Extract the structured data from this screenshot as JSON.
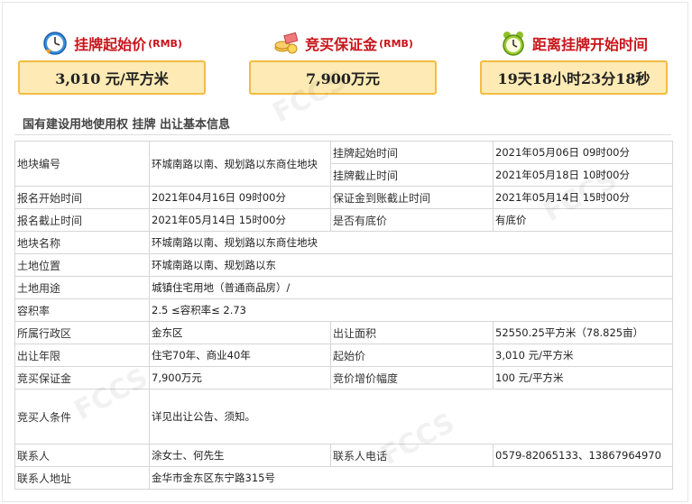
{
  "panels": [
    {
      "title": "挂牌起始价",
      "unit": "(RMB)",
      "icon": "clock-icon",
      "value": "3,010 元/平方米"
    },
    {
      "title": "竞买保证金",
      "unit": "(RMB)",
      "icon": "money-icon",
      "value": "7,900万元"
    },
    {
      "title": "距离挂牌开始时间",
      "unit": "",
      "icon": "alarm-clock-icon",
      "value": "19天18小时23分18秒"
    }
  ],
  "section_title": "国有建设用地使用权 挂牌 出让基本信息",
  "table": {
    "r1": {
      "l1": "地块编号",
      "v1": "环城南路以南、规划路以东商住地块",
      "l2": "挂牌起始时间",
      "v2": "2021年05月06日 09时00分"
    },
    "r2": {
      "l2": "挂牌截止时间",
      "v2": "2021年05月18日 10时00分"
    },
    "r3": {
      "l1": "报名开始时间",
      "v1": "2021年04月16日 09时00分",
      "l2": "保证金到账截止时间",
      "v2": "2021年05月14日 15时00分"
    },
    "r4": {
      "l1": "报名截止时间",
      "v1": "2021年05月14日 15时00分",
      "l2": "是否有底价",
      "v2": "有底价"
    },
    "r5": {
      "l1": "地块名称",
      "v1": "环城南路以南、规划路以东商住地块"
    },
    "r6": {
      "l1": "土地位置",
      "v1": "环城南路以南、规划路以东"
    },
    "r7": {
      "l1": "土地用途",
      "v1": "城镇住宅用地（普通商品房）/"
    },
    "r8": {
      "l1": "容积率",
      "v1": "2.5 ≤容积率≤ 2.73"
    },
    "r9": {
      "l1": "所属行政区",
      "v1": "金东区",
      "l2": "出让面积",
      "v2": "52550.25平方米（78.825亩）"
    },
    "r10": {
      "l1": "出让年限",
      "v1": "住宅70年、商业40年",
      "l2": "起始价",
      "v2": "3,010 元/平方米"
    },
    "r11": {
      "l1": "竞买保证金",
      "v1": "7,900万元",
      "l2": "竞价增价幅度",
      "v2": "100 元/平方米"
    },
    "r12": {
      "l1": "竞买人条件",
      "v1": "详见出让公告、须知。"
    },
    "r13": {
      "l1": "联系人",
      "v1": "涂女士、何先生",
      "l2": "联系人电话",
      "v2": "0579-82065133、13867964970"
    },
    "r14": {
      "l1": "联系人地址",
      "v1": "金华市金东区东宁路315号"
    }
  }
}
